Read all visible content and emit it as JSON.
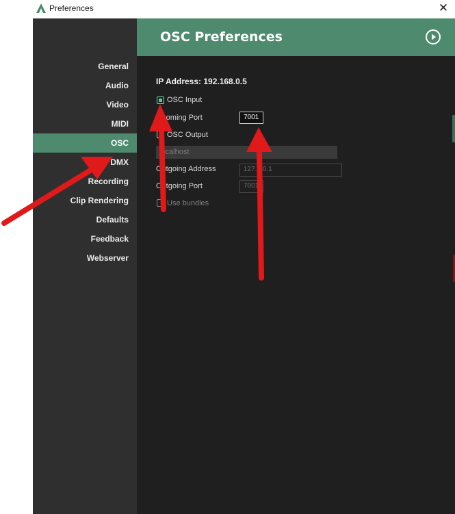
{
  "window": {
    "title": "Preferences",
    "close_glyph": "✕"
  },
  "sidebar": {
    "items": [
      {
        "label": "General"
      },
      {
        "label": "Audio"
      },
      {
        "label": "Video"
      },
      {
        "label": "MIDI"
      },
      {
        "label": "OSC",
        "selected": true
      },
      {
        "label": "DMX"
      },
      {
        "label": "Recording"
      },
      {
        "label": "Clip Rendering"
      },
      {
        "label": "Defaults"
      },
      {
        "label": "Feedback"
      },
      {
        "label": "Webserver"
      }
    ]
  },
  "header": {
    "title": "OSC Preferences",
    "play_icon": "play-circle-icon"
  },
  "osc": {
    "ip_address": "IP Address: 192.168.0.5",
    "osc_input_label": "OSC Input",
    "osc_input_checked": true,
    "incoming_port_label": "Incoming Port",
    "incoming_port_value": "7001",
    "osc_output_label": "OSC Output",
    "osc_output_checked": false,
    "output_target": "localhost",
    "outgoing_address_label": "Outgoing Address",
    "outgoing_address_value": "127.0.0.1",
    "outgoing_port_label": "Outgoing Port",
    "outgoing_port_value": "7001",
    "use_bundles_label": "Use bundles",
    "use_bundles_checked": false
  },
  "colors": {
    "accent": "#4e8a6d",
    "sidebar_bg": "#2f2f2f",
    "content_bg": "#1f1f1f",
    "annotation_arrow": "#e0191b"
  }
}
